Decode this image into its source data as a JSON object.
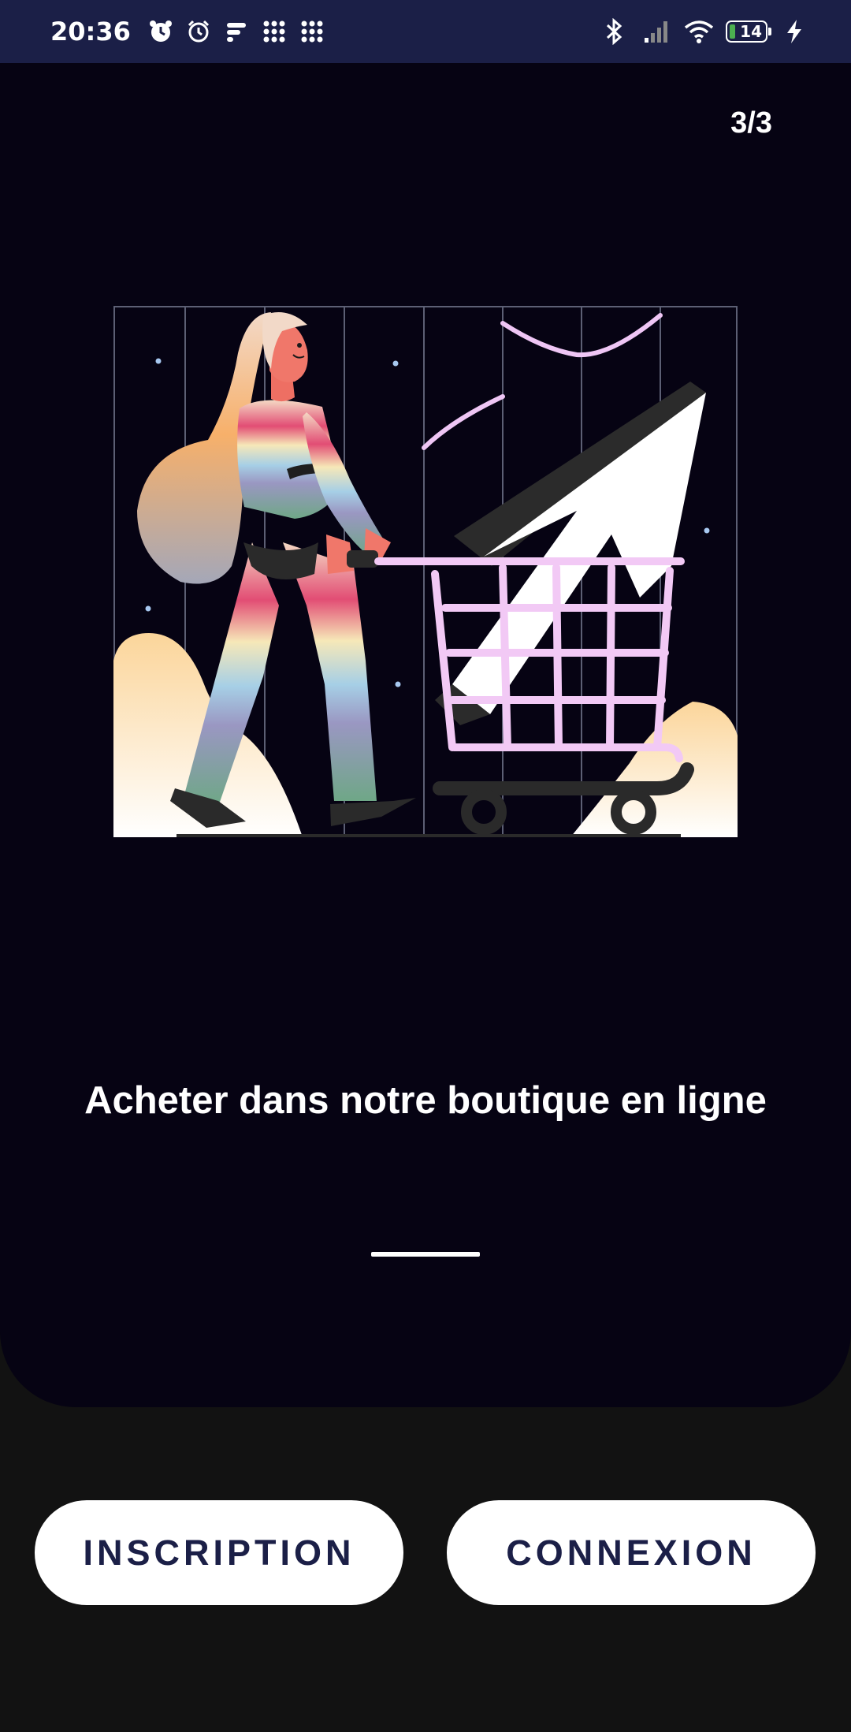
{
  "status_bar": {
    "time": "20:36",
    "left_icons": [
      "alarm-icon",
      "alarm-clock-icon",
      "app-notification-icon",
      "grid-app-icon",
      "grid-app-icon"
    ],
    "right_icons": [
      "bluetooth-icon",
      "signal-icon",
      "wifi-icon",
      "battery-icon",
      "charging-icon"
    ],
    "battery_level": "14",
    "battery_color": "#4caf50"
  },
  "onboarding": {
    "page_counter": "3/3",
    "headline": "Acheter dans notre boutique en ligne",
    "illustration": "woman-shopping-cart-illustration"
  },
  "actions": {
    "signup_label": "INSCRIPTION",
    "login_label": "CONNEXION"
  },
  "colors": {
    "status_bar_bg": "#1b1f47",
    "card_bg": "#060313",
    "page_bg": "#121212",
    "button_bg": "#ffffff",
    "button_text": "#1b1f47",
    "cart_pink": "#f2c9f5"
  }
}
